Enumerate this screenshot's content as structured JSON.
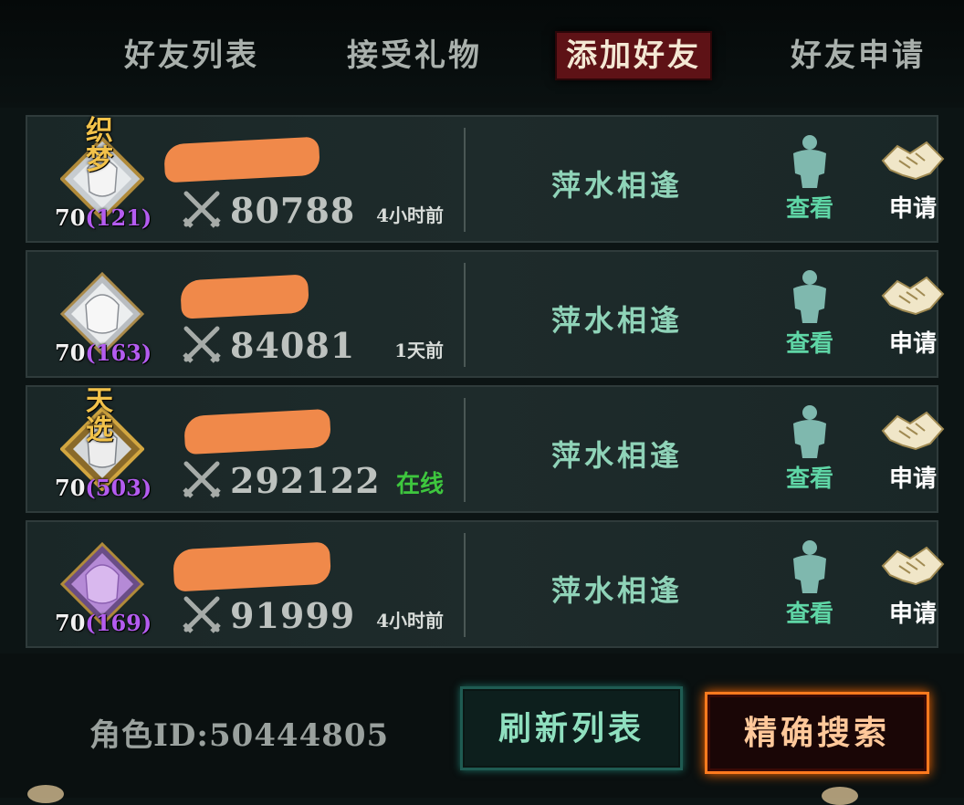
{
  "tabs": [
    {
      "label": "好友列表",
      "active": false
    },
    {
      "label": "接受礼物",
      "active": false
    },
    {
      "label": "添加好友",
      "active": true
    },
    {
      "label": "好友申请",
      "active": false
    }
  ],
  "players": [
    {
      "badge": "织梦",
      "level": "70",
      "rank": "(121)",
      "power": "80788",
      "last_seen": "4小时前",
      "online": false,
      "position": "萍水相逢",
      "view_label": "查看",
      "apply_label": "申请"
    },
    {
      "badge": "",
      "level": "70",
      "rank": "(163)",
      "power": "84081",
      "last_seen": "1天前",
      "online": false,
      "position": "萍水相逢",
      "view_label": "查看",
      "apply_label": "申请"
    },
    {
      "badge": "天选",
      "level": "70",
      "rank": "(503)",
      "power": "292122",
      "last_seen": "在线",
      "online": true,
      "position": "萍水相逢",
      "view_label": "查看",
      "apply_label": "申请"
    },
    {
      "badge": "",
      "level": "70",
      "rank": "(169)",
      "power": "91999",
      "last_seen": "4小时前",
      "online": false,
      "position": "萍水相逢",
      "view_label": "查看",
      "apply_label": "申请"
    }
  ],
  "footer": {
    "role_id": "角色ID:50444805",
    "refresh_label": "刷新列表",
    "search_label": "精确搜索"
  },
  "icons": {
    "swords": "crossed-swords-icon",
    "view": "person-silhouette-icon",
    "apply": "handshake-icon"
  },
  "colors": {
    "active_tab": "#5e1216",
    "online": "#3ec63e",
    "rank": "#b45cf0",
    "search_glow": "#ff6a00"
  }
}
